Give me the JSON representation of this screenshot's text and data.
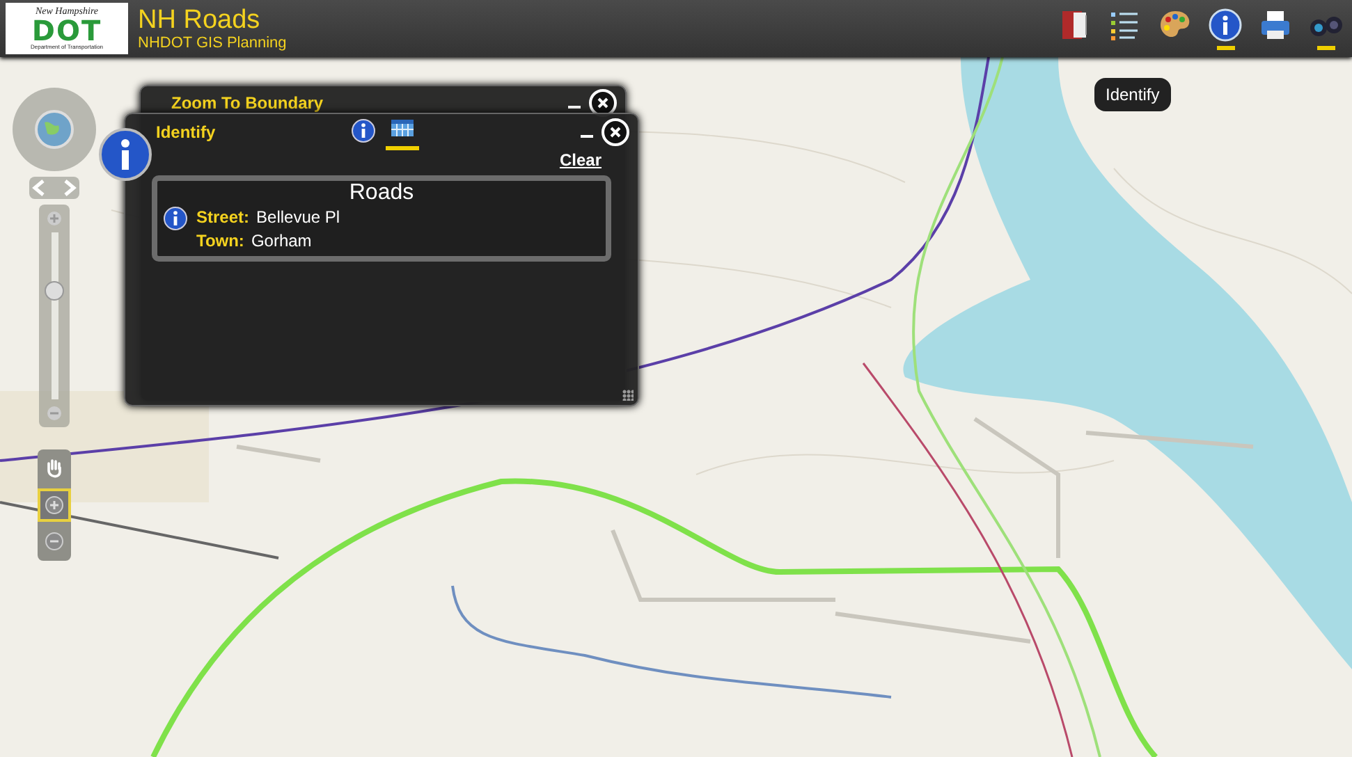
{
  "header": {
    "logo": {
      "top": "New Hampshire",
      "mark": "DOT",
      "bottom": "Department of Transportation"
    },
    "title": "NH Roads",
    "subtitle": "NHDOT GIS Planning"
  },
  "toolbar": [
    {
      "kind": "book",
      "open": false
    },
    {
      "kind": "legend",
      "open": false
    },
    {
      "kind": "palette",
      "open": false
    },
    {
      "kind": "info",
      "open": true
    },
    {
      "kind": "printer",
      "open": false
    },
    {
      "kind": "binoculars",
      "open": true
    }
  ],
  "tooltip": "Identify",
  "nav": {
    "zoom": {
      "level": 0.65
    },
    "tools": [
      {
        "kind": "pan",
        "selected": false
      },
      {
        "kind": "zoom-in",
        "selected": true
      },
      {
        "kind": "zoom-out",
        "selected": false
      }
    ]
  },
  "boundary_panel": {
    "title": "Zoom To Boundary"
  },
  "identify_panel": {
    "title": "Identify",
    "tabs": [
      {
        "kind": "info",
        "selected": false
      },
      {
        "kind": "table",
        "selected": true
      }
    ],
    "clear": "Clear",
    "result": {
      "layer": "Roads",
      "fields": [
        {
          "label": "Street:",
          "value": "Bellevue Pl"
        },
        {
          "label": "Town:",
          "value": "Gorham"
        }
      ]
    }
  }
}
